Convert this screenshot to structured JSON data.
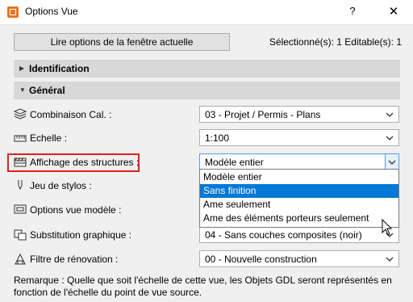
{
  "window": {
    "title": "Options Vue",
    "help_glyph": "?",
    "close_glyph": "✕"
  },
  "top": {
    "read_button": "Lire options de la fenêtre actuelle",
    "selection_info": "Sélectionné(s): 1 Editable(s): 1"
  },
  "sections": {
    "identification": "Identification",
    "general": "Général"
  },
  "rows": {
    "combinaison": {
      "label": "Combinaison Cal. :",
      "value": "03 - Projet / Permis - Plans"
    },
    "echelle": {
      "label": "Echelle :",
      "value": "1:100"
    },
    "affichage": {
      "label": "Affichage des structures :",
      "value": "Modèle entier"
    },
    "jeu_stylos": {
      "label": "Jeu de stylos :"
    },
    "options_modele": {
      "label": "Options vue modèle :"
    },
    "substitution": {
      "label": "Substitution graphique :",
      "value": "04 - Sans couches composites (noir)"
    },
    "filtre": {
      "label": "Filtre de rénovation :",
      "value": "00 - Nouvelle construction"
    }
  },
  "dropdown": {
    "options": [
      "Modèle entier",
      "Sans finition",
      "Ame seulement",
      "Ame des éléments porteurs seulement"
    ],
    "highlighted": "Sans finition"
  },
  "remark": "Remarque : Quelle que soit l'échelle de cette vue, les Objets GDL seront représentés en fonction de l'échelle du point de vue source.",
  "colors": {
    "highlight": "#0078d7",
    "annotation_border": "#e02020",
    "app_icon": "#e8741c"
  }
}
